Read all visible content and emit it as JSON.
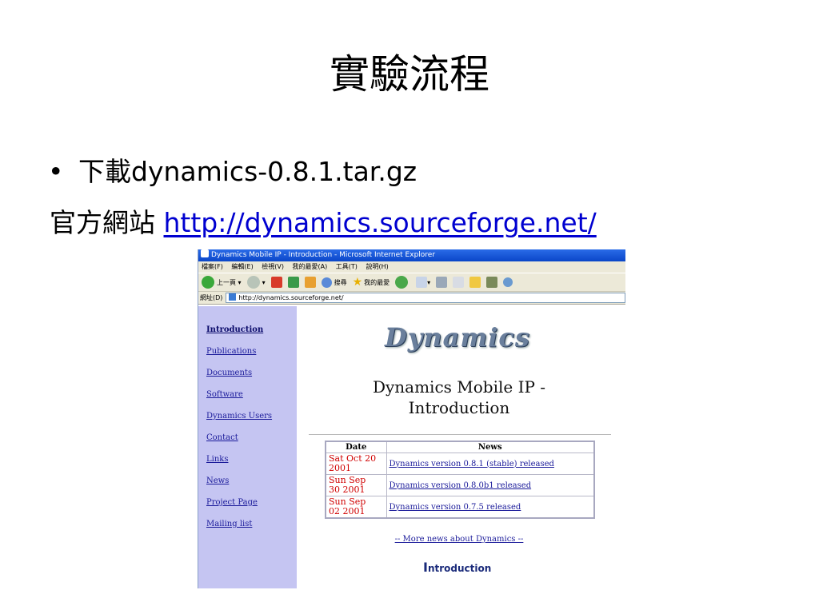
{
  "slide": {
    "title": "實驗流程",
    "bullet_text": "下載dynamics-0.8.1.tar.gz",
    "site_label": "官方網站",
    "site_url": "http://dynamics.sourceforge.net/"
  },
  "browser": {
    "window_title": "Dynamics Mobile IP - Introduction - Microsoft Internet Explorer",
    "menu": [
      "檔案(F)",
      "編輯(E)",
      "檢視(V)",
      "我的最愛(A)",
      "工具(T)",
      "說明(H)"
    ],
    "toolbar": {
      "back_label": "上一頁",
      "search_label": "搜尋",
      "favorites_label": "我的最愛"
    },
    "address_label": "網址(D)",
    "address_value": "http://dynamics.sourceforge.net/",
    "sidebar": [
      "Introduction",
      "Publications",
      "Documents",
      "Software",
      "Dynamics Users",
      "Contact",
      "Links",
      "News",
      "Project Page",
      "Mailing list"
    ],
    "logo_text": "Dynamics",
    "heading_line1": "Dynamics Mobile IP -",
    "heading_line2": "Introduction",
    "news_table": {
      "headers": [
        "Date",
        "News"
      ],
      "rows": [
        {
          "date_line1": "Sat Oct 20",
          "date_line2": "2001",
          "news": "Dynamics version 0.8.1 (stable) released"
        },
        {
          "date_line1": "Sun Sep",
          "date_line2": "30 2001",
          "news": "Dynamics version 0.8.0b1 released"
        },
        {
          "date_line1": "Sun Sep",
          "date_line2": "02 2001",
          "news": "Dynamics version 0.7.5 released"
        }
      ]
    },
    "more_news": "-- More news about Dynamics --",
    "intro_heading_initial": "I",
    "intro_heading_rest": "ntroduction"
  }
}
